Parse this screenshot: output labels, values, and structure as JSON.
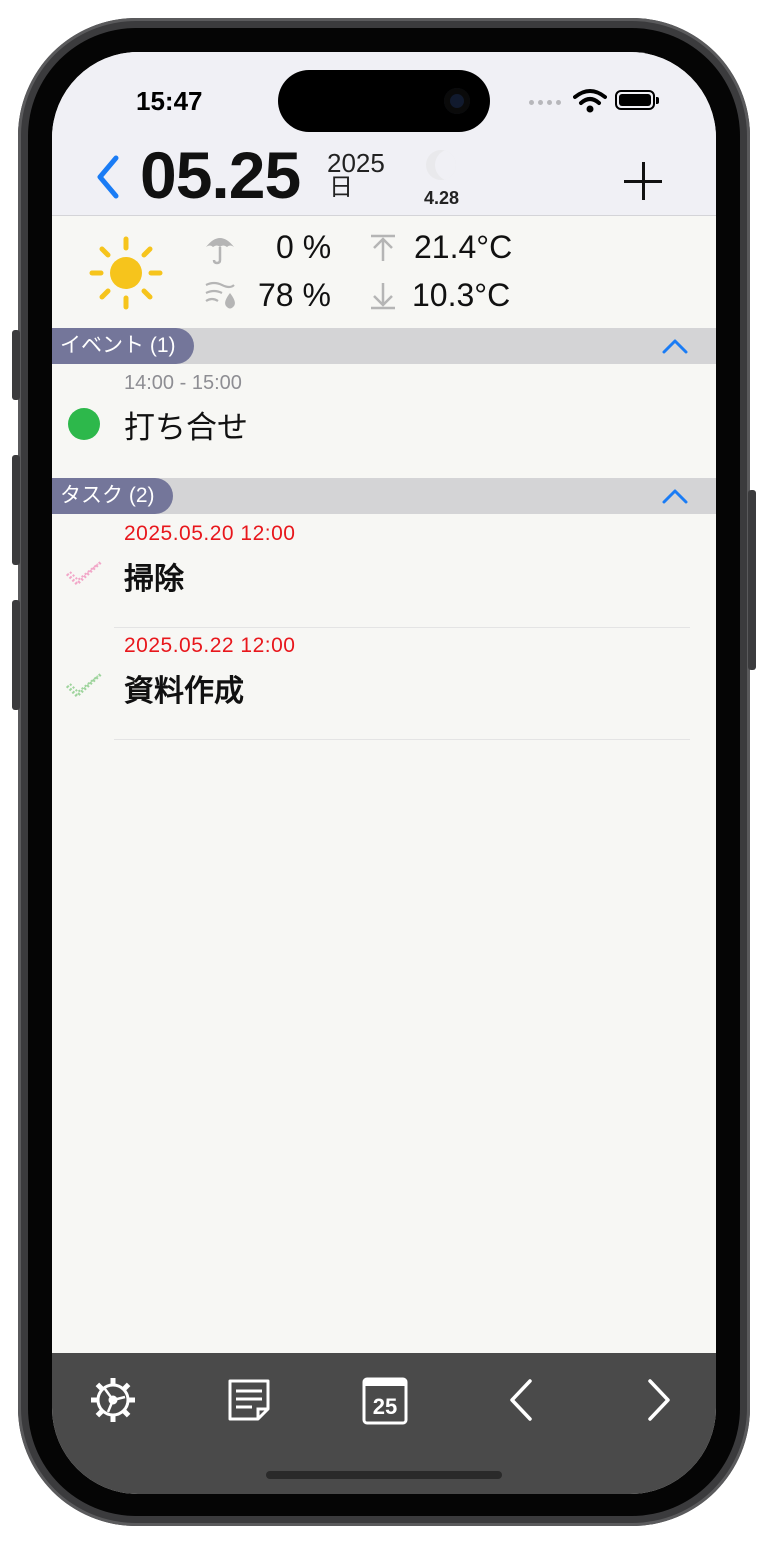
{
  "status_bar": {
    "time": "15:47"
  },
  "header": {
    "date": "05.25",
    "year": "2025",
    "weekday": "日",
    "moon_age": "4.28"
  },
  "weather": {
    "rain_chance": "0 %",
    "humidity": "78 %",
    "temp_high": "21.4°C",
    "temp_low": "10.3°C"
  },
  "events": {
    "header": "イベント (1)",
    "items": [
      {
        "time": "14:00 - 15:00",
        "title": "打ち合せ",
        "color": "#2db84b"
      }
    ]
  },
  "tasks": {
    "header": "タスク (2)",
    "items": [
      {
        "due": "2025.05.20  12:00",
        "title": "掃除",
        "check_color": "#f2a7c8"
      },
      {
        "due": "2025.05.22  12:00",
        "title": "資料作成",
        "check_color": "#9ed49c"
      }
    ]
  },
  "toolbar": {
    "icons": [
      "gear-icon",
      "note-icon",
      "calendar-icon",
      "chevron-left-icon",
      "chevron-right-icon"
    ],
    "calendar_day": "25"
  },
  "colors": {
    "accent": "#1a7cf5",
    "section_pill": "#74769a",
    "task_date": "#e8171c",
    "toolbar": "#4a4a4a"
  }
}
